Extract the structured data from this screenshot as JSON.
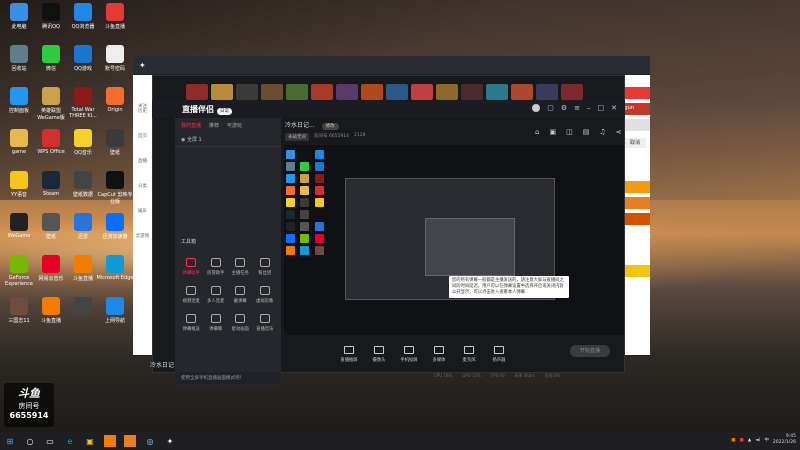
{
  "desktop_icons": [
    {
      "label": "此电脑",
      "color": "#3a8ee6"
    },
    {
      "label": "腾讯QQ",
      "color": "#111111"
    },
    {
      "label": "QQ浏览器",
      "color": "#1e88e5"
    },
    {
      "label": "斗鱼直播",
      "color": "#e53935"
    },
    {
      "label": "回收站",
      "color": "#607d8b"
    },
    {
      "label": "微信",
      "color": "#2ecc40"
    },
    {
      "label": "QQ游戏",
      "color": "#1976d2"
    },
    {
      "label": "账号密码",
      "color": "#eeeeee"
    },
    {
      "label": "控制面板",
      "color": "#2196f3"
    },
    {
      "label": "英雄联盟WeGame版",
      "color": "#c8a24a"
    },
    {
      "label": "Total War THREE KI...",
      "color": "#8b1a1a"
    },
    {
      "label": "Origin",
      "color": "#f56c2d"
    },
    {
      "label": "game",
      "color": "#e6b94c"
    },
    {
      "label": "WPS Office",
      "color": "#d32f2f"
    },
    {
      "label": "QQ音乐",
      "color": "#f6d12a"
    },
    {
      "label": "壁纸",
      "color": "#3a3a3a"
    },
    {
      "label": "YY语音",
      "color": "#f6c61a"
    },
    {
      "label": "Steam",
      "color": "#1b2838"
    },
    {
      "label": "壁纸数据",
      "color": "#444444"
    },
    {
      "label": "CapCut 剪映专业版",
      "color": "#111111"
    },
    {
      "label": "WeGame",
      "color": "#222222"
    },
    {
      "label": "壁纸",
      "color": "#555555"
    },
    {
      "label": "迅雷",
      "color": "#2b73d8"
    },
    {
      "label": "迅游加速器",
      "color": "#0d6efd"
    },
    {
      "label": "GeForce Experience",
      "color": "#76b900"
    },
    {
      "label": "网易云音乐",
      "color": "#e60026"
    },
    {
      "label": "斗鱼直播",
      "color": "#f57c00"
    },
    {
      "label": "Microsoft Edge",
      "color": "#0f9bd7"
    },
    {
      "label": "三国志11",
      "color": "#6d4c41"
    },
    {
      "label": "斗鱼直播",
      "color": "#f57c00"
    },
    {
      "label": "",
      "color": "#444444"
    },
    {
      "label": "上网导航",
      "color": "#1e88e5"
    }
  ],
  "host_nav": [
    "关注",
    "历史",
    "首页",
    "直播",
    "分类",
    "娱乐",
    "云游戏"
  ],
  "app": {
    "title": "直播伴侣",
    "badge": "日常",
    "tabs": [
      "我的直播",
      "推荐",
      "可游玩"
    ],
    "scene": "全屏 1",
    "tools_heading": "工具箱",
    "tools": [
      {
        "label": "弹幕助手",
        "active": true
      },
      {
        "label": "房管助手",
        "active": false
      },
      {
        "label": "主播任务",
        "active": false
      },
      {
        "label": "粉丝团",
        "active": false
      },
      {
        "label": "视频连麦",
        "active": false
      },
      {
        "label": "多人连麦",
        "active": false
      },
      {
        "label": "截弹幕",
        "active": false
      },
      {
        "label": "虚拟形象",
        "active": false
      },
      {
        "label": "弹幕推送",
        "active": false
      },
      {
        "label": "弹幕聊",
        "active": false
      },
      {
        "label": "星动画面",
        "active": false
      },
      {
        "label": "直播音乐",
        "active": false
      }
    ],
    "tip": "使用全屏手机直播画面模式吧！",
    "stream_title": "冷水日记...",
    "edit_label": "修改",
    "chip_category": "永劫无间",
    "meta_room": "房间号 6655914",
    "meta_hot": "2128",
    "tooltip_text": "您的所有弹幕一般都是主播发送的，请注意大屏与直播间之间的时间延迟。用户可以在弹幕设置中选择开启或关闭内容公开显示，可以点击进入查看本人弹幕",
    "controls": [
      "直播推屏",
      "摄像头",
      "手机投屏",
      "多媒体",
      "麦克风",
      "扬声器"
    ],
    "start_button": "开始直播",
    "status": [
      "CPU 18%",
      "GPU 32%",
      "FPS 60",
      "码率 0kb/s",
      "丢帧 0%"
    ],
    "side_button": "取消"
  },
  "overlay": {
    "brand": "斗鱼",
    "room_label": "房间号",
    "room_id": "6655914",
    "watermark": "冷水日记"
  },
  "taskbar": {
    "tray_time": "9:45",
    "tray_date": "2022/1/26"
  },
  "right_game": "Shogun"
}
